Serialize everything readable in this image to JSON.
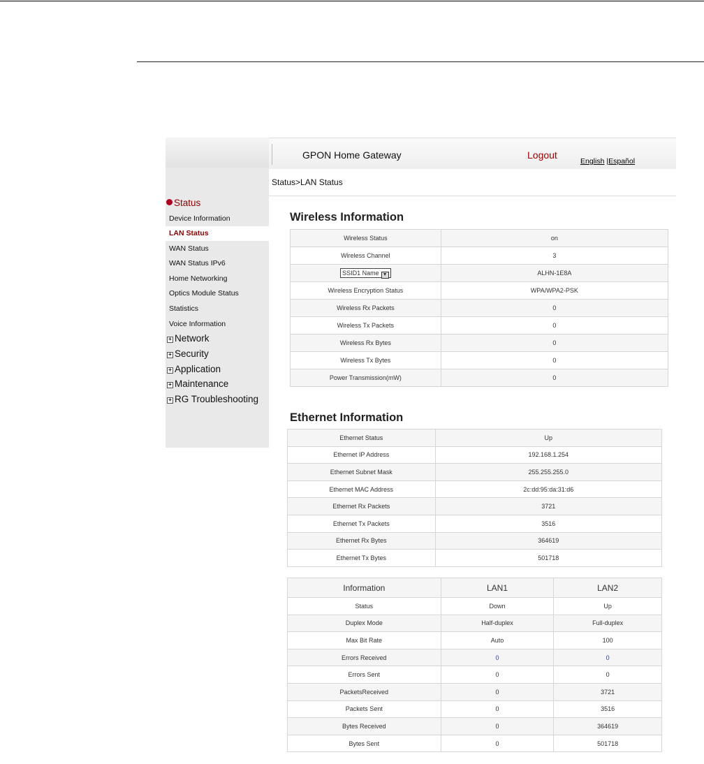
{
  "header": {
    "title": "GPON Home Gateway",
    "logout": "Logout",
    "lang_english": "English",
    "lang_sep": "|",
    "lang_espanol": "Español"
  },
  "breadcrumb": "Status>LAN Status",
  "sidebar": {
    "status_group": "Status",
    "items": [
      "Device Information",
      "LAN Status",
      "WAN Status",
      "WAN Status IPv6",
      "Home Networking",
      "Optics Module Status",
      "Statistics",
      "Voice Information"
    ],
    "groups": [
      "Network",
      "Security",
      "Application",
      "Maintenance",
      "RG Troubleshooting"
    ],
    "expand_glyph": "+"
  },
  "wireless": {
    "heading": "Wireless Information",
    "ssid_select": "SSID1 Name",
    "ssid_arrow": "▼",
    "rows": [
      {
        "label": "Wireless Status",
        "value": "on"
      },
      {
        "label": "Wireless Channel",
        "value": "3"
      },
      {
        "label": "",
        "value": "ALHN-1E8A"
      },
      {
        "label": "Wireless Encryption Status",
        "value": "WPA/WPA2-PSK"
      },
      {
        "label": "Wireless Rx Packets",
        "value": "0"
      },
      {
        "label": "Wireless Tx Packets",
        "value": "0"
      },
      {
        "label": "Wireless Rx Bytes",
        "value": "0"
      },
      {
        "label": "Wireless Tx Bytes",
        "value": "0"
      },
      {
        "label": "Power Transmission(mW)",
        "value": "0"
      }
    ]
  },
  "ethernet": {
    "heading": "Ethernet Information",
    "rows": [
      {
        "label": "Ethernet Status",
        "value": "Up"
      },
      {
        "label": "Ethernet IP Address",
        "value": "192.168.1.254"
      },
      {
        "label": "Ethernet Subnet Mask",
        "value": "255.255.255.0"
      },
      {
        "label": "Ethernet MAC Address",
        "value": "2c:dd:95:da:31:d6"
      },
      {
        "label": "Ethernet Rx Packets",
        "value": "3721"
      },
      {
        "label": "Ethernet Tx Packets",
        "value": "3516"
      },
      {
        "label": "Ethernet Rx Bytes",
        "value": "364619"
      },
      {
        "label": "Ethernet Tx Bytes",
        "value": "501718"
      }
    ]
  },
  "lan": {
    "headers": [
      "Information",
      "LAN1",
      "LAN2"
    ],
    "rows": [
      {
        "label": "Status",
        "lan1": "Down",
        "lan2": "Up"
      },
      {
        "label": "Duplex Mode",
        "lan1": "Half-duplex",
        "lan2": "Full-duplex"
      },
      {
        "label": "Max Bit Rate",
        "lan1": "Auto",
        "lan2": "100"
      },
      {
        "label": "Errors Received",
        "lan1": "0",
        "lan2": "0"
      },
      {
        "label": "Errors Sent",
        "lan1": "0",
        "lan2": "0"
      },
      {
        "label": "PacketsReceived",
        "lan1": "0",
        "lan2": "3721"
      },
      {
        "label": "Packets Sent",
        "lan1": "0",
        "lan2": "3516"
      },
      {
        "label": "Bytes Received",
        "lan1": "0",
        "lan2": "364619"
      },
      {
        "label": "Bytes Sent",
        "lan1": "0",
        "lan2": "501718"
      }
    ]
  },
  "colors": {
    "accent_red": "#8b0000",
    "logout_red": "#a00000",
    "link_blue": "#2a3f9a"
  }
}
